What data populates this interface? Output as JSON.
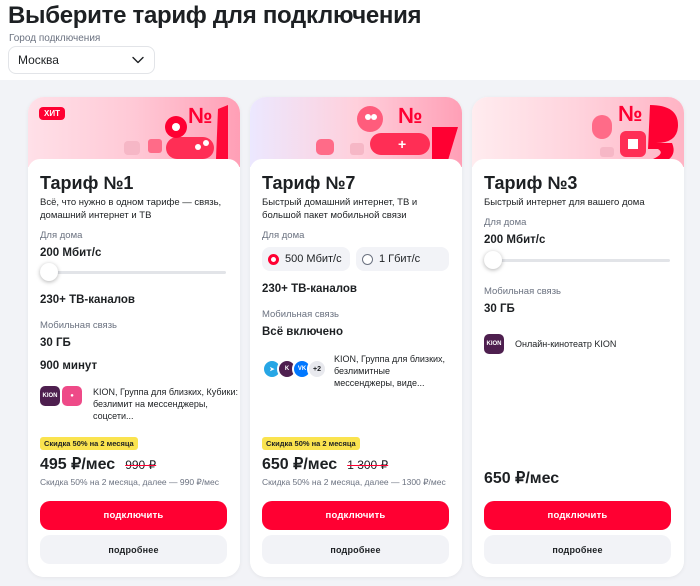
{
  "page": {
    "title": "Выберите тариф для подключения"
  },
  "city": {
    "label": "Город подключения",
    "value": "Москва",
    "icon": "chevron-down-icon"
  },
  "colors": {
    "accent": "#ff0032",
    "promo": "#fae34f",
    "muted": "#6b7280",
    "surface": "#f2f3f7"
  },
  "cards": [
    {
      "badge": "ХИТ",
      "hero_number": "№ 1",
      "title": "Тариф №1",
      "desc": "Всё, что нужно в одном тарифе — связь, домашний интернет и ТВ",
      "home_label": "Для дома",
      "speed": "200 Мбит/с",
      "slider_value": 0,
      "tv": "230+ ТВ-каналов",
      "mobile_label": "Мобильная связь",
      "data": "30 ГБ",
      "minutes": "900 минут",
      "apps_text": "KION, Группа для близких, Кубики: безлимит на мессенджеры, соцсети...",
      "promo": "Скидка 50% на 2 месяца",
      "price": "495 ₽/мес",
      "old_price": "990 ₽",
      "price_note": "Скидка 50% на 2 месяца, далее — 990 ₽/мес",
      "connect": "подключить",
      "more": "подробнее"
    },
    {
      "hero_number": "№ 7",
      "title": "Тариф №7",
      "desc": "Быстрый домашний интернет, ТВ и большой пакет мобильной связи",
      "home_label": "Для дома",
      "speed_options": [
        "500 Мбит/с",
        "1 Гбит/с"
      ],
      "selected_speed": "500 Мбит/с",
      "tv": "230+ ТВ-каналов",
      "mobile_label": "Мобильная связь",
      "mobile_value": "Всё включено",
      "apps_more": "+2",
      "apps_text": "KION, Группа для близких, безлимитные мессенджеры, виде...",
      "promo": "Скидка 50% на 2 месяца",
      "price": "650 ₽/мес",
      "old_price": "1 300 ₽",
      "price_note": "Скидка 50% на 2 месяца, далее — 1300 ₽/мес",
      "connect": "подключить",
      "more": "подробнее"
    },
    {
      "hero_number": "№ 3",
      "title": "Тариф №3",
      "desc": "Быстрый интернет для вашего дома",
      "home_label": "Для дома",
      "speed": "200 Мбит/с",
      "slider_value": 0,
      "mobile_label": "Мобильная связь",
      "data": "30 ГБ",
      "app_name": "Онлайн-кинотеатр KION",
      "app_logo_text": "KION",
      "price": "650 ₽/мес",
      "connect": "подключить",
      "more": "подробнее"
    }
  ]
}
